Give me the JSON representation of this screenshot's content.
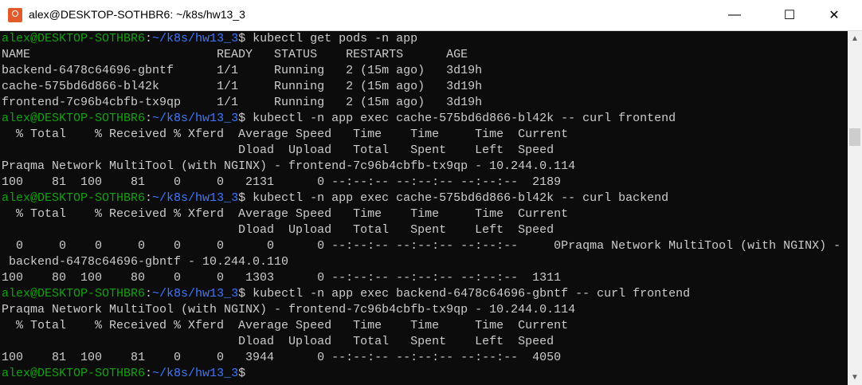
{
  "window": {
    "title": "alex@DESKTOP-SOTHBR6: ~/k8s/hw13_3",
    "minimize": "—",
    "maximize": "☐",
    "close": "✕"
  },
  "colors": {
    "background": "#0c0c0c",
    "text": "#cccccc",
    "prompt_user": "#13a10e",
    "prompt_path": "#3b78ff"
  },
  "prompt": {
    "user": "alex@DESKTOP-SOTHBR6",
    "sep": ":",
    "path": "~/k8s/hw13_3",
    "dollar": "$"
  },
  "lines": [
    {
      "prompt": true,
      "text": " kubectl get pods -n app"
    },
    {
      "text": "NAME                          READY   STATUS    RESTARTS      AGE"
    },
    {
      "text": "backend-6478c64696-gbntf      1/1     Running   2 (15m ago)   3d19h"
    },
    {
      "text": "cache-575bd6d866-bl42k        1/1     Running   2 (15m ago)   3d19h"
    },
    {
      "text": "frontend-7c96b4cbfb-tx9qp     1/1     Running   2 (15m ago)   3d19h"
    },
    {
      "prompt": true,
      "text": " kubectl -n app exec cache-575bd6d866-bl42k -- curl frontend"
    },
    {
      "text": "  % Total    % Received % Xferd  Average Speed   Time    Time     Time  Current"
    },
    {
      "text": "                                 Dload  Upload   Total   Spent    Left  Speed"
    },
    {
      "text": "Praqma Network MultiTool (with NGINX) - frontend-7c96b4cbfb-tx9qp - 10.244.0.114"
    },
    {
      "text": "100    81  100    81    0     0   2131      0 --:--:-- --:--:-- --:--:--  2189"
    },
    {
      "prompt": true,
      "text": " kubectl -n app exec cache-575bd6d866-bl42k -- curl backend"
    },
    {
      "text": "  % Total    % Received % Xferd  Average Speed   Time    Time     Time  Current"
    },
    {
      "text": "                                 Dload  Upload   Total   Spent    Left  Speed"
    },
    {
      "text": "  0     0    0     0    0     0      0      0 --:--:-- --:--:-- --:--:--     0Praqma Network MultiTool (with NGINX) -"
    },
    {
      "text": " backend-6478c64696-gbntf - 10.244.0.110"
    },
    {
      "text": "100    80  100    80    0     0   1303      0 --:--:-- --:--:-- --:--:--  1311"
    },
    {
      "prompt": true,
      "text": " kubectl -n app exec backend-6478c64696-gbntf -- curl frontend"
    },
    {
      "text": "Praqma Network MultiTool (with NGINX) - frontend-7c96b4cbfb-tx9qp - 10.244.0.114"
    },
    {
      "text": "  % Total    % Received % Xferd  Average Speed   Time    Time     Time  Current"
    },
    {
      "text": "                                 Dload  Upload   Total   Spent    Left  Speed"
    },
    {
      "text": "100    81  100    81    0     0   3944      0 --:--:-- --:--:-- --:--:--  4050"
    },
    {
      "prompt": true,
      "text": ""
    }
  ]
}
